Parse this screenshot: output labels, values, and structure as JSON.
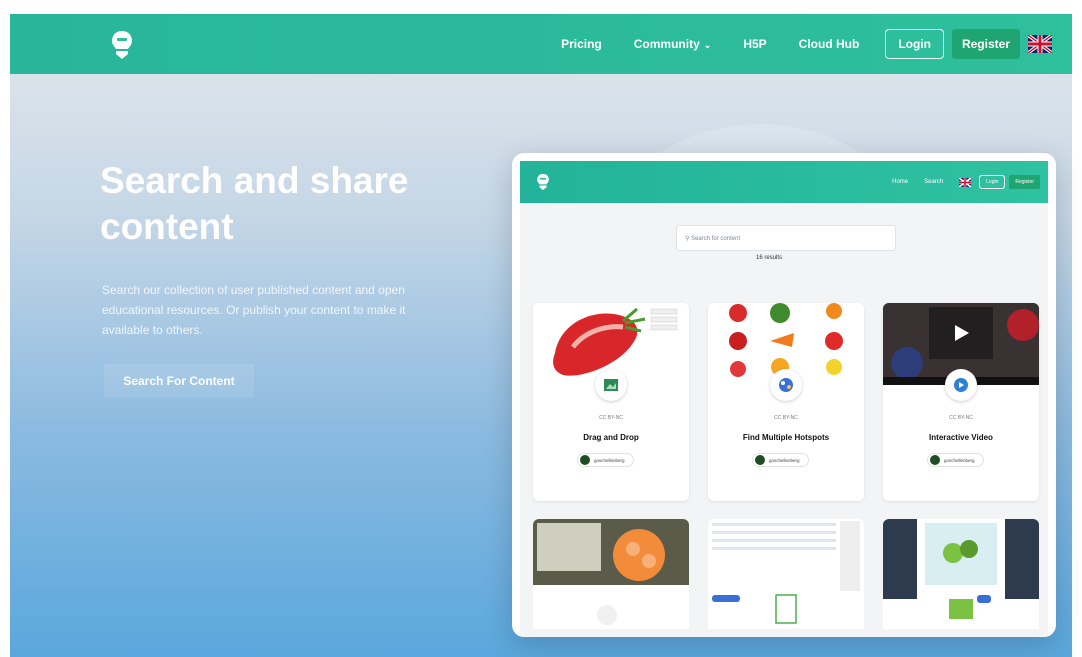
{
  "nav": {
    "links": [
      {
        "label": "Pricing",
        "dropdown": false
      },
      {
        "label": "Community",
        "dropdown": true
      },
      {
        "label": "H5P",
        "dropdown": false
      },
      {
        "label": "Cloud Hub",
        "dropdown": false
      }
    ],
    "login_label": "Login",
    "register_label": "Register",
    "language_icon": "uk-flag-icon"
  },
  "hero": {
    "title": "Search and share content",
    "description": "Search our collection of user published content and open educational resources. Or publish your content to make it available to others.",
    "cta_label": "Search For Content"
  },
  "preview": {
    "nav_links": [
      "Home",
      "Search"
    ],
    "login_label": "Login",
    "register_label": "Register",
    "search_placeholder": "Search for content",
    "results": "16 results",
    "cards": [
      {
        "license": "CC BY-NC",
        "title": "Drag and Drop",
        "author": "goschellenberg",
        "icon": "drag-drop-icon"
      },
      {
        "license": "CC BY-NC",
        "title": "Find Multiple Hotspots",
        "author": "goschellenberg",
        "icon": "hotspots-icon"
      },
      {
        "license": "CC BY-NC",
        "title": "Interactive Video",
        "author": "goschellenberg",
        "icon": "interactive-video-icon"
      }
    ]
  },
  "colors": {
    "brand": "#2ebf9c",
    "register": "#1fa572",
    "hero_top": "#dbe3ea",
    "hero_bottom": "#5aa7dd"
  }
}
